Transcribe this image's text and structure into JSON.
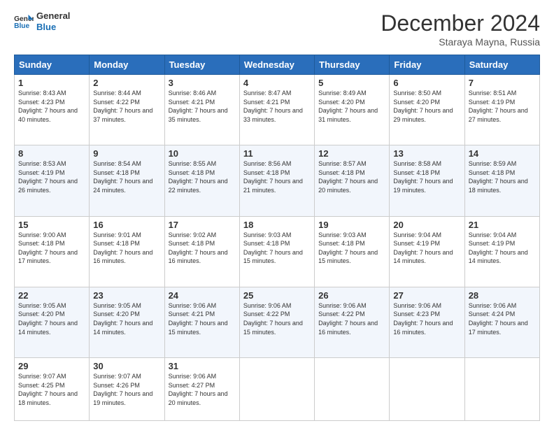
{
  "header": {
    "logo_line1": "General",
    "logo_line2": "Blue",
    "month_title": "December 2024",
    "location": "Staraya Mayna, Russia"
  },
  "days_of_week": [
    "Sunday",
    "Monday",
    "Tuesday",
    "Wednesday",
    "Thursday",
    "Friday",
    "Saturday"
  ],
  "weeks": [
    [
      {
        "day": "1",
        "sunrise": "8:43 AM",
        "sunset": "4:23 PM",
        "daylight": "7 hours and 40 minutes."
      },
      {
        "day": "2",
        "sunrise": "8:44 AM",
        "sunset": "4:22 PM",
        "daylight": "7 hours and 37 minutes."
      },
      {
        "day": "3",
        "sunrise": "8:46 AM",
        "sunset": "4:21 PM",
        "daylight": "7 hours and 35 minutes."
      },
      {
        "day": "4",
        "sunrise": "8:47 AM",
        "sunset": "4:21 PM",
        "daylight": "7 hours and 33 minutes."
      },
      {
        "day": "5",
        "sunrise": "8:49 AM",
        "sunset": "4:20 PM",
        "daylight": "7 hours and 31 minutes."
      },
      {
        "day": "6",
        "sunrise": "8:50 AM",
        "sunset": "4:20 PM",
        "daylight": "7 hours and 29 minutes."
      },
      {
        "day": "7",
        "sunrise": "8:51 AM",
        "sunset": "4:19 PM",
        "daylight": "7 hours and 27 minutes."
      }
    ],
    [
      {
        "day": "8",
        "sunrise": "8:53 AM",
        "sunset": "4:19 PM",
        "daylight": "7 hours and 26 minutes."
      },
      {
        "day": "9",
        "sunrise": "8:54 AM",
        "sunset": "4:18 PM",
        "daylight": "7 hours and 24 minutes."
      },
      {
        "day": "10",
        "sunrise": "8:55 AM",
        "sunset": "4:18 PM",
        "daylight": "7 hours and 22 minutes."
      },
      {
        "day": "11",
        "sunrise": "8:56 AM",
        "sunset": "4:18 PM",
        "daylight": "7 hours and 21 minutes."
      },
      {
        "day": "12",
        "sunrise": "8:57 AM",
        "sunset": "4:18 PM",
        "daylight": "7 hours and 20 minutes."
      },
      {
        "day": "13",
        "sunrise": "8:58 AM",
        "sunset": "4:18 PM",
        "daylight": "7 hours and 19 minutes."
      },
      {
        "day": "14",
        "sunrise": "8:59 AM",
        "sunset": "4:18 PM",
        "daylight": "7 hours and 18 minutes."
      }
    ],
    [
      {
        "day": "15",
        "sunrise": "9:00 AM",
        "sunset": "4:18 PM",
        "daylight": "7 hours and 17 minutes."
      },
      {
        "day": "16",
        "sunrise": "9:01 AM",
        "sunset": "4:18 PM",
        "daylight": "7 hours and 16 minutes."
      },
      {
        "day": "17",
        "sunrise": "9:02 AM",
        "sunset": "4:18 PM",
        "daylight": "7 hours and 16 minutes."
      },
      {
        "day": "18",
        "sunrise": "9:03 AM",
        "sunset": "4:18 PM",
        "daylight": "7 hours and 15 minutes."
      },
      {
        "day": "19",
        "sunrise": "9:03 AM",
        "sunset": "4:18 PM",
        "daylight": "7 hours and 15 minutes."
      },
      {
        "day": "20",
        "sunrise": "9:04 AM",
        "sunset": "4:19 PM",
        "daylight": "7 hours and 14 minutes."
      },
      {
        "day": "21",
        "sunrise": "9:04 AM",
        "sunset": "4:19 PM",
        "daylight": "7 hours and 14 minutes."
      }
    ],
    [
      {
        "day": "22",
        "sunrise": "9:05 AM",
        "sunset": "4:20 PM",
        "daylight": "7 hours and 14 minutes."
      },
      {
        "day": "23",
        "sunrise": "9:05 AM",
        "sunset": "4:20 PM",
        "daylight": "7 hours and 14 minutes."
      },
      {
        "day": "24",
        "sunrise": "9:06 AM",
        "sunset": "4:21 PM",
        "daylight": "7 hours and 15 minutes."
      },
      {
        "day": "25",
        "sunrise": "9:06 AM",
        "sunset": "4:22 PM",
        "daylight": "7 hours and 15 minutes."
      },
      {
        "day": "26",
        "sunrise": "9:06 AM",
        "sunset": "4:22 PM",
        "daylight": "7 hours and 16 minutes."
      },
      {
        "day": "27",
        "sunrise": "9:06 AM",
        "sunset": "4:23 PM",
        "daylight": "7 hours and 16 minutes."
      },
      {
        "day": "28",
        "sunrise": "9:06 AM",
        "sunset": "4:24 PM",
        "daylight": "7 hours and 17 minutes."
      }
    ],
    [
      {
        "day": "29",
        "sunrise": "9:07 AM",
        "sunset": "4:25 PM",
        "daylight": "7 hours and 18 minutes."
      },
      {
        "day": "30",
        "sunrise": "9:07 AM",
        "sunset": "4:26 PM",
        "daylight": "7 hours and 19 minutes."
      },
      {
        "day": "31",
        "sunrise": "9:06 AM",
        "sunset": "4:27 PM",
        "daylight": "7 hours and 20 minutes."
      },
      null,
      null,
      null,
      null
    ]
  ],
  "labels": {
    "sunrise": "Sunrise:",
    "sunset": "Sunset:",
    "daylight": "Daylight:"
  }
}
